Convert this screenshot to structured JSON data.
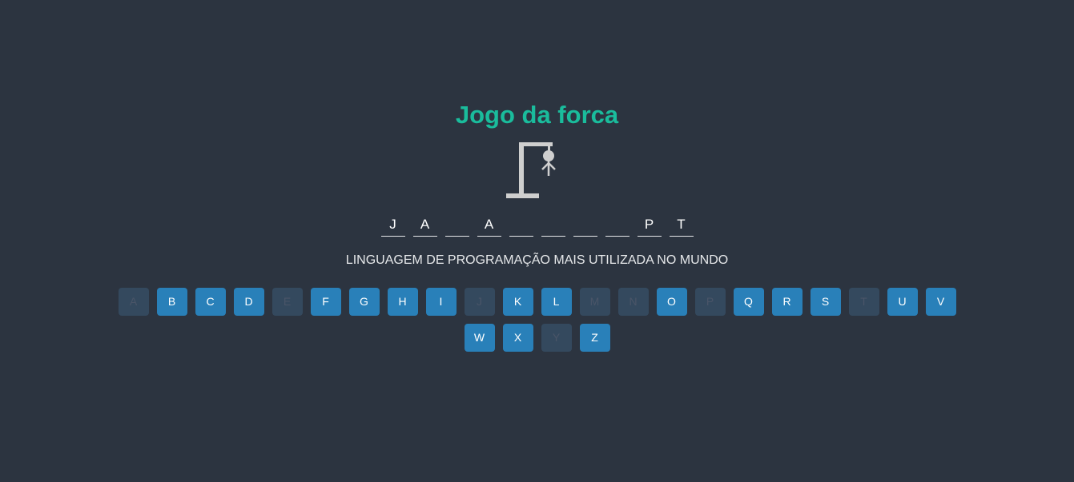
{
  "title": "Jogo da forca",
  "colors": {
    "background": "#2c3440",
    "title": "#1abc9c",
    "key_active": "#2980b9",
    "key_disabled": "#34495e",
    "key_disabled_text": "#4a5568",
    "gallows": "#cfcfcf"
  },
  "gallows_stage": "head-body-arms",
  "word": [
    "J",
    "A",
    "",
    "A",
    "",
    "",
    "",
    "",
    "P",
    "T"
  ],
  "hint": "LINGUAGEM DE PROGRAMAÇÃO MAIS UTILIZADA NO MUNDO",
  "keyboard": {
    "rows": [
      [
        {
          "letter": "A",
          "disabled": true
        },
        {
          "letter": "B",
          "disabled": false
        },
        {
          "letter": "C",
          "disabled": false
        },
        {
          "letter": "D",
          "disabled": false
        },
        {
          "letter": "E",
          "disabled": true
        },
        {
          "letter": "F",
          "disabled": false
        },
        {
          "letter": "G",
          "disabled": false
        },
        {
          "letter": "H",
          "disabled": false
        },
        {
          "letter": "I",
          "disabled": false
        },
        {
          "letter": "J",
          "disabled": true
        },
        {
          "letter": "K",
          "disabled": false
        },
        {
          "letter": "L",
          "disabled": false
        },
        {
          "letter": "M",
          "disabled": true
        },
        {
          "letter": "N",
          "disabled": true
        },
        {
          "letter": "O",
          "disabled": false
        },
        {
          "letter": "P",
          "disabled": true
        },
        {
          "letter": "Q",
          "disabled": false
        },
        {
          "letter": "R",
          "disabled": false
        },
        {
          "letter": "S",
          "disabled": false
        },
        {
          "letter": "T",
          "disabled": true
        },
        {
          "letter": "U",
          "disabled": false
        },
        {
          "letter": "V",
          "disabled": false
        }
      ],
      [
        {
          "letter": "W",
          "disabled": false
        },
        {
          "letter": "X",
          "disabled": false
        },
        {
          "letter": "Y",
          "disabled": true
        },
        {
          "letter": "Z",
          "disabled": false
        }
      ]
    ]
  }
}
